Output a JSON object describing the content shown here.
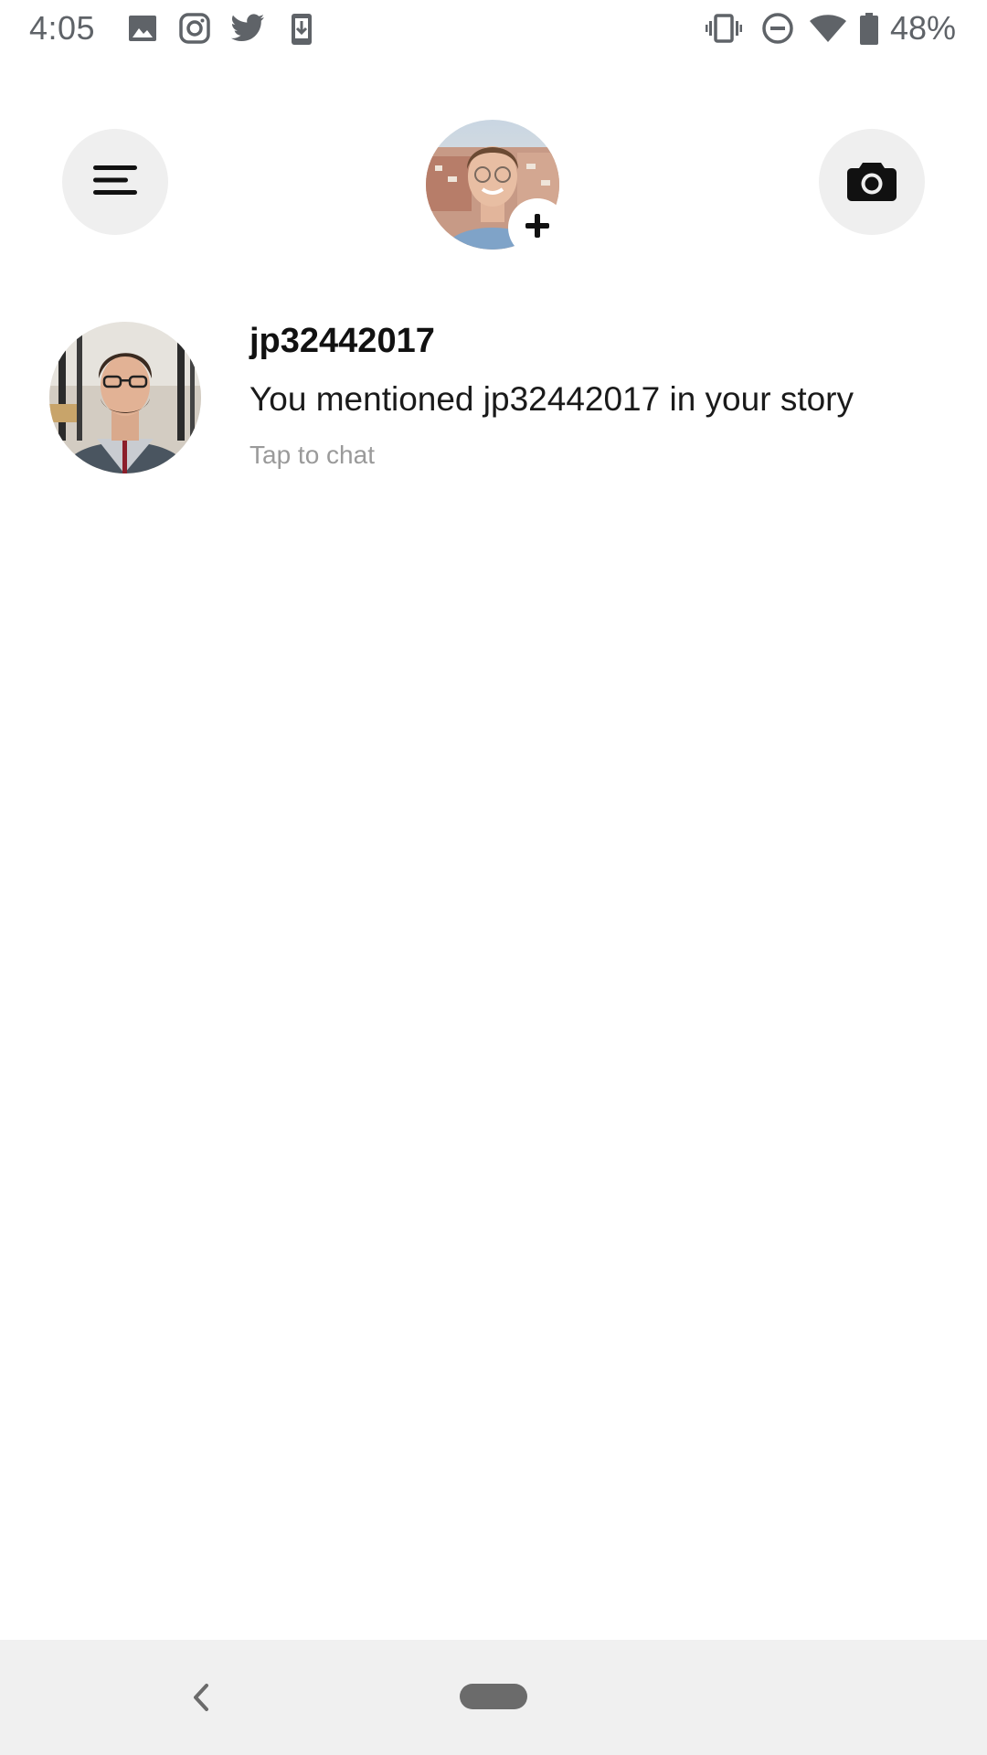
{
  "status_bar": {
    "time": "4:05",
    "battery": "48%",
    "left_icons": [
      "gallery-icon",
      "instagram-icon",
      "twitter-icon",
      "download-icon"
    ],
    "right_icons": [
      "vibrate-icon",
      "do-not-disturb-icon",
      "wifi-icon",
      "battery-icon"
    ]
  },
  "top_bar": {
    "menu_icon": "hamburger-menu-icon",
    "camera_icon": "camera-icon",
    "add_story_icon": "plus-icon"
  },
  "chats": [
    {
      "name": "jp32442017",
      "message": "You mentioned jp32442017 in your story",
      "hint": "Tap to chat"
    }
  ],
  "colors": {
    "button_bg": "#efefef",
    "nav_bg": "#f0f0f0",
    "hint_text": "#9a9a9a",
    "status_text": "#5f6368"
  }
}
